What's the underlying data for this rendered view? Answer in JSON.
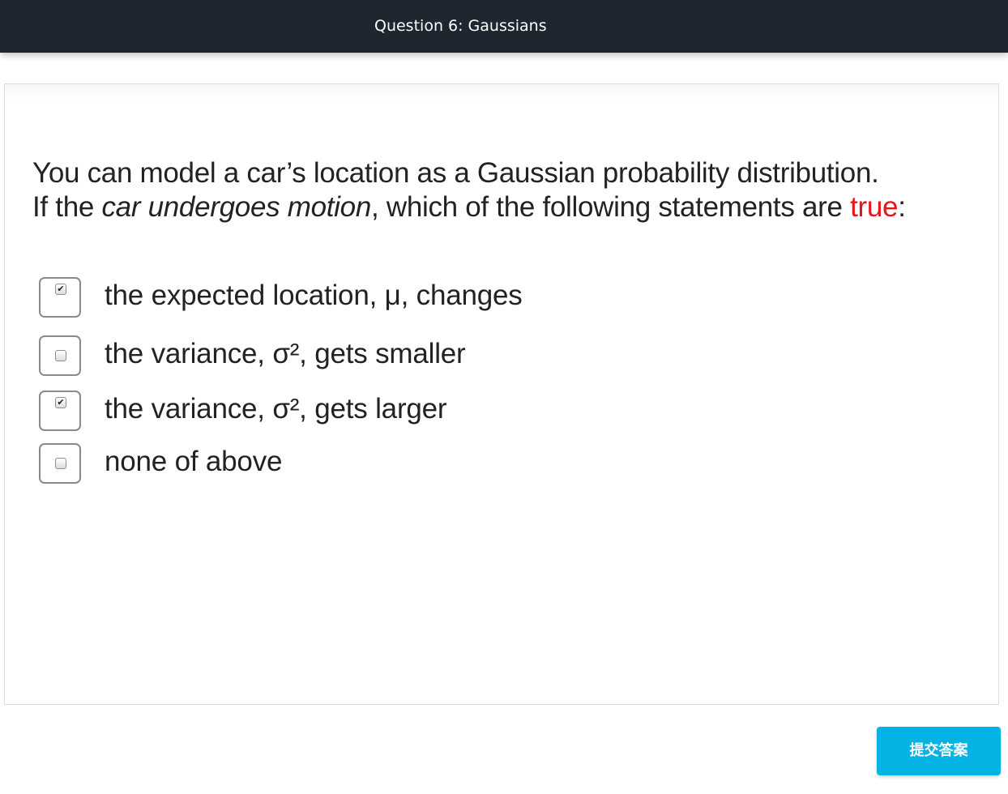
{
  "header": {
    "title": "Question 6: Gaussians"
  },
  "question": {
    "line1": "You can model a car’s location as a Gaussian probability distribution.",
    "line2_prefix": "If the ",
    "line2_italic": "car undergoes motion",
    "line2_middle": ", which of the following statements are ",
    "line2_red": "true",
    "line2_suffix": ":"
  },
  "options": [
    {
      "label": "the expected location, μ, changes",
      "checked": true,
      "check_glyph": "✔"
    },
    {
      "label": "the variance, σ², gets smaller",
      "checked": false,
      "check_glyph": ""
    },
    {
      "label": "the variance, σ², gets larger",
      "checked": true,
      "check_glyph": "✔"
    },
    {
      "label": "none of above",
      "checked": false,
      "check_glyph": ""
    }
  ],
  "submit": {
    "label": "提交答案"
  },
  "colors": {
    "header_bg": "#1f2630",
    "accent": "#02b3e4",
    "emphasis_red": "#e8131b"
  }
}
